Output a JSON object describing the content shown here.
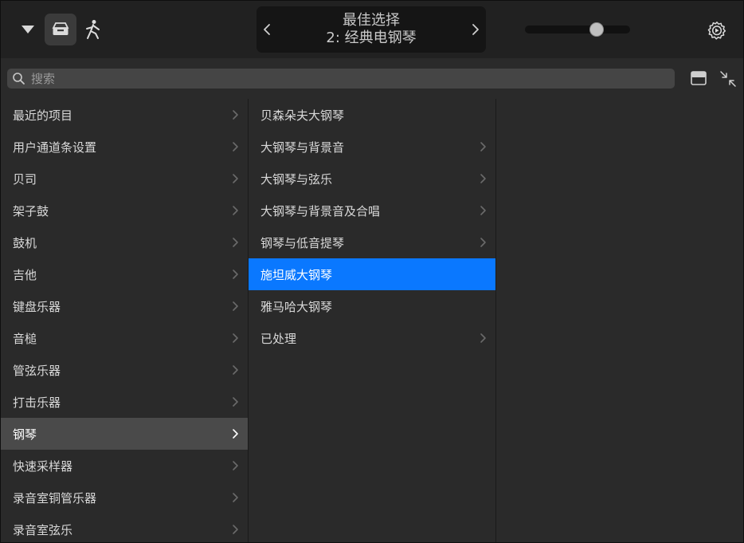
{
  "toolbar": {
    "lcd_title": "最佳选择",
    "lcd_subtitle": "2: 经典电钢琴",
    "volume_level": 0.68
  },
  "search": {
    "placeholder": "搜索"
  },
  "categories": [
    {
      "label": "最近的项目",
      "has_children": true
    },
    {
      "label": "用户通道条设置",
      "has_children": true
    },
    {
      "label": "贝司",
      "has_children": true
    },
    {
      "label": "架子鼓",
      "has_children": true
    },
    {
      "label": "鼓机",
      "has_children": true
    },
    {
      "label": "吉他",
      "has_children": true
    },
    {
      "label": "键盘乐器",
      "has_children": true
    },
    {
      "label": "音槌",
      "has_children": true
    },
    {
      "label": "管弦乐器",
      "has_children": true
    },
    {
      "label": "打击乐器",
      "has_children": true
    },
    {
      "label": "钢琴",
      "has_children": true,
      "selected": true
    },
    {
      "label": "快速采样器",
      "has_children": true
    },
    {
      "label": "录音室铜管乐器",
      "has_children": true
    },
    {
      "label": "录音室弦乐",
      "has_children": true
    }
  ],
  "patches": [
    {
      "label": "贝森朵夫大钢琴",
      "has_children": false
    },
    {
      "label": "大钢琴与背景音",
      "has_children": true
    },
    {
      "label": "大钢琴与弦乐",
      "has_children": true
    },
    {
      "label": "大钢琴与背景音及合唱",
      "has_children": true
    },
    {
      "label": "钢琴与低音提琴",
      "has_children": true
    },
    {
      "label": "施坦威大钢琴",
      "has_children": false,
      "selected": true
    },
    {
      "label": "雅马哈大钢琴",
      "has_children": false
    },
    {
      "label": "已处理",
      "has_children": true
    }
  ],
  "colors": {
    "accent": "#0a78ff",
    "selection_gray": "#4a4a4a",
    "background": "#2a2a2a",
    "toolbar": "#212121"
  },
  "icons": {
    "menu": "triangle-down-icon",
    "library": "library-tray-icon",
    "perform": "figure-icon",
    "prev": "chevron-left-icon",
    "next": "chevron-right-icon",
    "settings": "gear-icon",
    "search": "search-icon",
    "layout": "layout-split-icon",
    "collapse": "collapse-arrows-icon"
  }
}
